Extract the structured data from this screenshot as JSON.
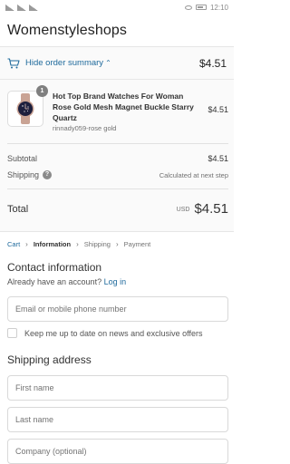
{
  "status_bar": {
    "time": "12:10"
  },
  "store": {
    "name": "Womenstyleshops"
  },
  "summary_toggle": {
    "label": "Hide order summary",
    "total": "$4.51"
  },
  "order": {
    "items": [
      {
        "quantity": "1",
        "name": "Hot Top Brand Watches For Woman Rose Gold Mesh Magnet Buckle Starry Quartz",
        "variant": "rinnady059-rose gold",
        "price": "$4.51"
      }
    ],
    "subtotal_label": "Subtotal",
    "subtotal_value": "$4.51",
    "shipping_label": "Shipping",
    "shipping_value": "Calculated at next step",
    "total_label": "Total",
    "currency": "USD",
    "total_value": "$4.51"
  },
  "breadcrumb": [
    "Cart",
    "Information",
    "Shipping",
    "Payment"
  ],
  "contact": {
    "title": "Contact information",
    "have_account": "Already have an account?",
    "login_link": "Log in",
    "email_placeholder": "Email or mobile phone number",
    "newsletter_label": "Keep me up to date on news and exclusive offers"
  },
  "shipping_address": {
    "title": "Shipping address",
    "first_name_placeholder": "First name",
    "last_name_placeholder": "Last name",
    "company_placeholder": "Company (optional)"
  },
  "colors": {
    "link": "#1f6a9c",
    "text": "#333333",
    "muted": "#737373",
    "border": "#d9d9d9",
    "panel_bg": "#fafafa"
  }
}
